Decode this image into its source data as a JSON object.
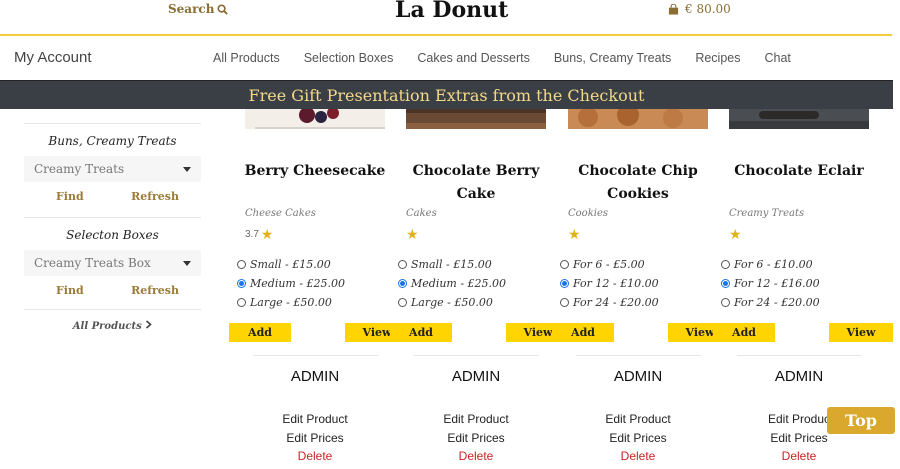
{
  "header": {
    "search_label": "Search",
    "brand": "La Donut",
    "cart_total": "€ 80.00"
  },
  "nav": {
    "account": "My Account",
    "items": [
      "All Products",
      "Selection Boxes",
      "Cakes and Desserts",
      "Buns, Creamy Treats",
      "Recipes",
      "Chat"
    ]
  },
  "banner": "Free Gift Presentation Extras from the Checkout",
  "sidebar": {
    "sections": [
      {
        "title": "Buns, Creamy Treats",
        "select_value": "Creamy Treats",
        "find": "Find",
        "refresh": "Refresh"
      },
      {
        "title": "Selecton Boxes",
        "select_value": "Creamy Treats Box",
        "find": "Find",
        "refresh": "Refresh"
      }
    ],
    "all_products": "All Products"
  },
  "products": [
    {
      "name": "Berry Cheesecake",
      "category": "Cheese Cakes",
      "rating": "3.7",
      "options": [
        "Small - £15.00",
        "Medium - £25.00",
        "Large - £50.00"
      ],
      "selected": 1,
      "add": "Add",
      "view": "View",
      "admin": "ADMIN",
      "edit_product": "Edit Product",
      "edit_prices": "Edit Prices",
      "delete": "Delete"
    },
    {
      "name": "Chocolate Berry Cake",
      "category": "Cakes",
      "rating": "",
      "options": [
        "Small - £15.00",
        "Medium - £25.00",
        "Large - £50.00"
      ],
      "selected": 1,
      "add": "Add",
      "view": "View",
      "admin": "ADMIN",
      "edit_product": "Edit Product",
      "edit_prices": "Edit Prices",
      "delete": "Delete"
    },
    {
      "name": "Chocolate Chip Cookies",
      "category": "Cookies",
      "rating": "",
      "options": [
        "For 6 - £5.00",
        "For 12 - £10.00",
        "For 24 - £20.00"
      ],
      "selected": 1,
      "add": "Add",
      "view": "View",
      "admin": "ADMIN",
      "edit_product": "Edit Product",
      "edit_prices": "Edit Prices",
      "delete": "Delete"
    },
    {
      "name": "Chocolate Eclair",
      "category": "Creamy Treats",
      "rating": "",
      "options": [
        "For 6 - £10.00",
        "For 12 - £16.00",
        "For 24 - £20.00"
      ],
      "selected": 1,
      "add": "Add",
      "view": "View",
      "admin": "ADMIN",
      "edit_product": "Edit Produc",
      "edit_prices": "Edit Prices",
      "delete": "Delete"
    }
  ],
  "top_button": "Top",
  "colors": {
    "gold": "#f1cd3e",
    "button_yellow": "#ffd400",
    "banner_bg": "#3a3f45",
    "link_brown": "#9a7a38",
    "delete_red": "#cc2222"
  },
  "icons": {
    "search": "search-icon",
    "cart": "shopping-bag-icon",
    "rating": "star-icon",
    "dropdown": "caret-down-icon",
    "chevron": "chevron-right-icon"
  }
}
